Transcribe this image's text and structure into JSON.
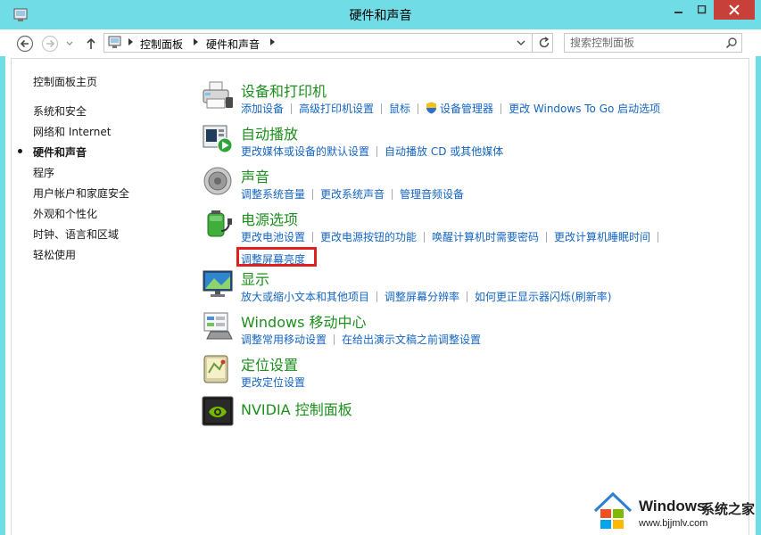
{
  "window": {
    "title": "硬件和声音"
  },
  "address": {
    "crumbs": [
      "控制面板",
      "硬件和声音"
    ]
  },
  "search": {
    "placeholder": "搜索控制面板"
  },
  "sidebar": {
    "items": [
      {
        "label": "控制面板主页"
      },
      {
        "label": "系统和安全"
      },
      {
        "label": "网络和 Internet"
      },
      {
        "label": "硬件和声音"
      },
      {
        "label": "程序"
      },
      {
        "label": "用户帐户和家庭安全"
      },
      {
        "label": "外观和个性化"
      },
      {
        "label": "时钟、语言和区域"
      },
      {
        "label": "轻松使用"
      }
    ]
  },
  "categories": [
    {
      "title": "设备和打印机",
      "icon": "printer-icon",
      "links": [
        "添加设备",
        "高级打印机设置",
        "鼠标",
        "设备管理器",
        "更改 Windows To Go 启动选项"
      ]
    },
    {
      "title": "自动播放",
      "icon": "autoplay-icon",
      "links": [
        "更改媒体或设备的默认设置",
        "自动播放 CD 或其他媒体"
      ]
    },
    {
      "title": "声音",
      "icon": "speaker-icon",
      "links": [
        "调整系统音量",
        "更改系统声音",
        "管理音频设备"
      ]
    },
    {
      "title": "电源选项",
      "icon": "battery-icon",
      "links": [
        "更改电池设置",
        "更改电源按钮的功能",
        "唤醒计算机时需要密码",
        "更改计算机睡眠时间",
        "调整屏幕亮度"
      ]
    },
    {
      "title": "显示",
      "icon": "display-icon",
      "links": [
        "放大或缩小文本和其他项目",
        "调整屏幕分辨率",
        "如何更正显示器闪烁(刷新率)"
      ]
    },
    {
      "title": "Windows 移动中心",
      "icon": "mobility-center-icon",
      "links": [
        "调整常用移动设置",
        "在给出演示文稿之前调整设置"
      ]
    },
    {
      "title": "定位设置",
      "icon": "location-icon",
      "links": [
        "更改定位设置"
      ]
    },
    {
      "title": "NVIDIA 控制面板",
      "icon": "nvidia-icon",
      "links": []
    }
  ],
  "watermark": {
    "brand": "Windows",
    "suffix": "系统之家",
    "url": "www.bjjmlv.com"
  },
  "colors": {
    "titlebar": "#6fdce6",
    "category_title": "#1c8f1c",
    "link": "#1565c0",
    "highlight_box": "#e02020"
  }
}
